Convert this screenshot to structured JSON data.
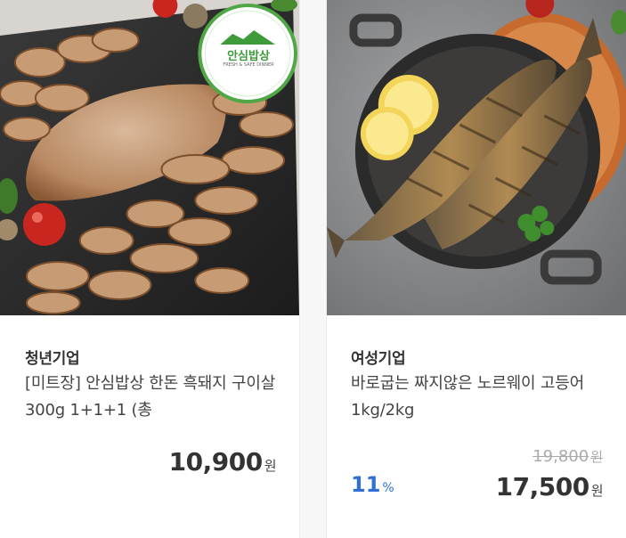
{
  "products": [
    {
      "seller": "청년기업",
      "name": "[미트장] 안심밥상 한돈 흑돼지 구이살 300g 1+1+1 (총",
      "price": "10,900",
      "currency": "원",
      "badge_text": "안심밥상",
      "badge_subtext": "FRESH & SAFE DINNER",
      "image_icon": "grilled-pork-photo"
    },
    {
      "seller": "여성기업",
      "name": "바로굽는 짜지않은 노르웨이 고등어 1kg/2kg",
      "original_price": "19,800",
      "discount": "11",
      "discount_unit": "%",
      "price": "17,500",
      "currency": "원",
      "image_icon": "grilled-mackerel-photo"
    }
  ],
  "colors": {
    "discount": "#2f6fd6",
    "price": "#333333",
    "original_price": "#aaaaaa"
  }
}
